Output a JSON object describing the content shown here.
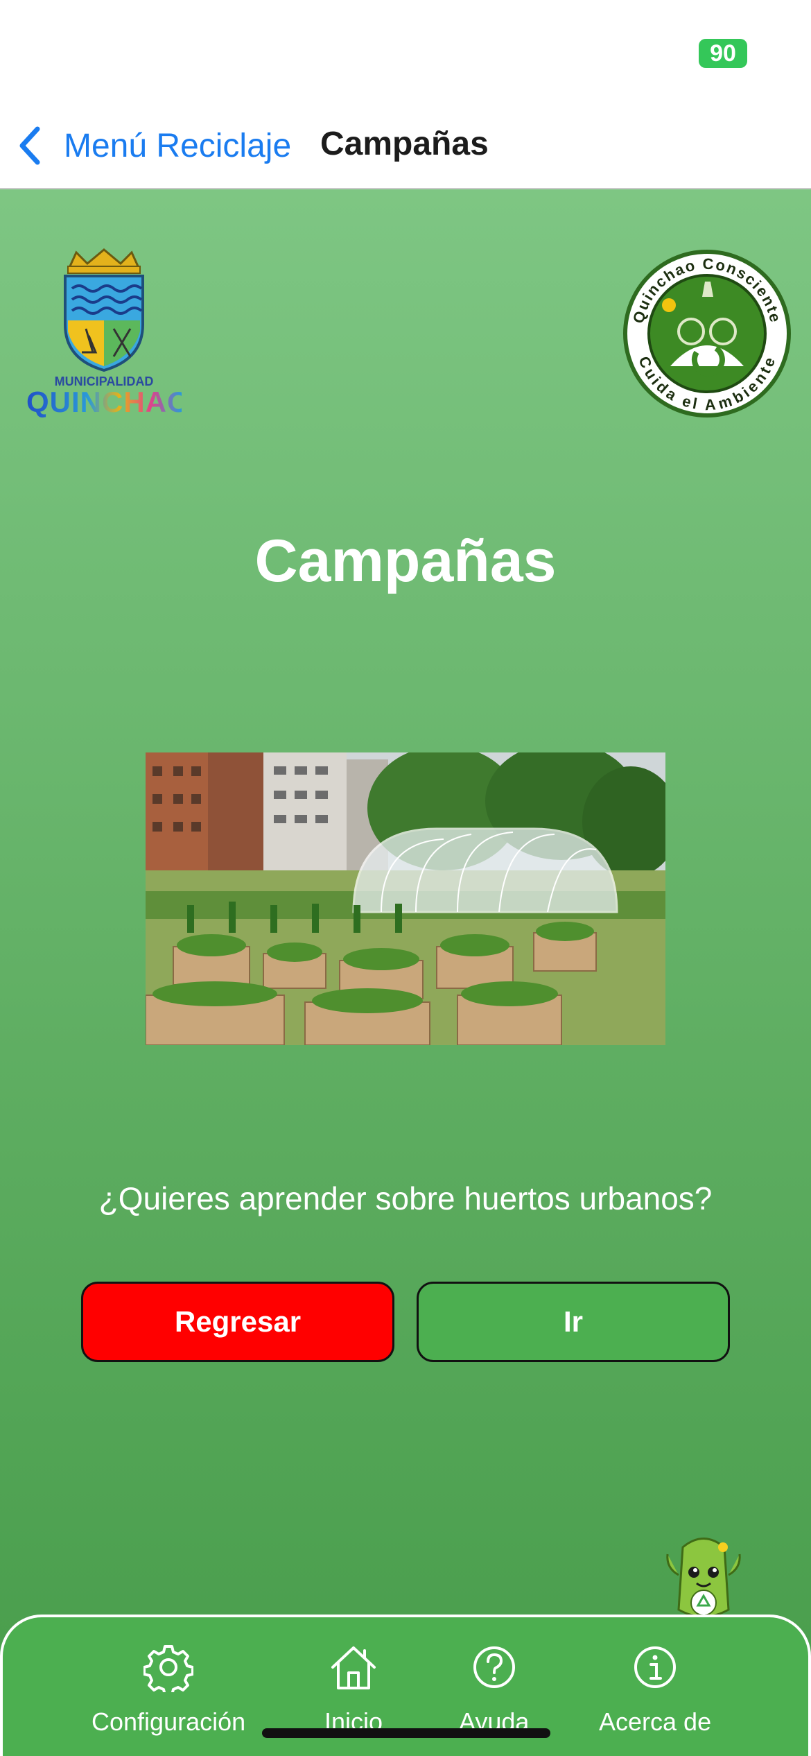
{
  "status_bar": {
    "battery": "90"
  },
  "nav": {
    "back_label": "Menú Reciclaje",
    "title": "Campañas"
  },
  "logos": {
    "municipal_small": "MUNICIPALIDAD",
    "municipal_big": "QUINCHAO",
    "conscious_top": "Quinchao Consciente",
    "conscious_bottom": "Cuida el Ambiente"
  },
  "page": {
    "heading": "Campañas",
    "question": "¿Quieres aprender sobre huertos urbanos?"
  },
  "buttons": {
    "back": "Regresar",
    "go": "Ir"
  },
  "tabs": [
    {
      "label": "Configuración",
      "icon": "gear-icon"
    },
    {
      "label": "Inicio",
      "icon": "home-icon"
    },
    {
      "label": "Ayuda",
      "icon": "help-icon"
    },
    {
      "label": "Acerca de",
      "icon": "info-icon"
    }
  ],
  "colors": {
    "accent_blue": "#1a7cf0",
    "back_button": "#ff0000",
    "go_button": "#4caf50",
    "tab_bar": "#4caf50",
    "battery": "#34c759"
  }
}
